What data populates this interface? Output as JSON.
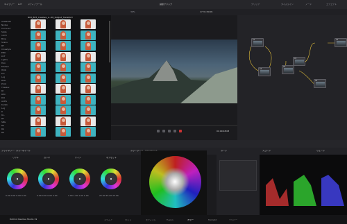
{
  "window": {
    "left_tabs": [
      "ギャラリー",
      "LUT",
      "メディアプール"
    ],
    "right_tabs": [
      "クリップ",
      "タイムライン",
      "ノード",
      "エフェクト"
    ],
    "timeline_name": "調整クリップ"
  },
  "media": {
    "header": "R03_BP3_Creative_L...08_Output_Transform",
    "folders": [
      "ALWSOFT",
      "Nodes",
      "Curve sd",
      "Slate",
      "1979",
      "Bmp",
      "Scans",
      "RT",
      "Cinestyle",
      "EMC",
      "LUT",
      "Lights",
      "Film",
      "Modern",
      "HDR",
      "Pro",
      "Log",
      "Raw",
      "Print",
      "Theater",
      "Rt",
      "REC",
      "DCI",
      "ACES",
      "Kodak",
      "Log",
      "D",
      "8 L",
      "RT",
      "SBG",
      "RG",
      "RG",
      "RG"
    ]
  },
  "viewer": {
    "zoom": "39%",
    "timecode": "01:00:48:03",
    "clip_code": "17:31:50:09"
  },
  "nodes": [
    {
      "label": "01"
    },
    {
      "label": "02"
    },
    {
      "label": "03"
    },
    {
      "label": "04"
    },
    {
      "label": "05"
    },
    {
      "label": "06"
    }
  ],
  "panels": {
    "primary": "プライマリー・カラーホイール",
    "curves": "カーブ",
    "scopes": "スコープ",
    "waveform": "ウェーブ",
    "hue": "カラーワープ・クロマワープ"
  },
  "wheels": [
    {
      "label": "リフト",
      "values": "0.00 0.00 0.00 0.00"
    },
    {
      "label": "ガンマ",
      "values": "0.00 0.00 0.00 0.00"
    },
    {
      "label": "ゲイン",
      "values": "1.00 1.00 1.00 1.00"
    },
    {
      "label": "オフセット",
      "values": "25.00 25.00 25.00"
    }
  ],
  "bottom_nav": [
    "メディア",
    "カット",
    "エディット",
    "Fusion",
    "カラー",
    "Fairlight",
    "デリバー"
  ],
  "app_name": "DaVinci Resolve Studio 19"
}
